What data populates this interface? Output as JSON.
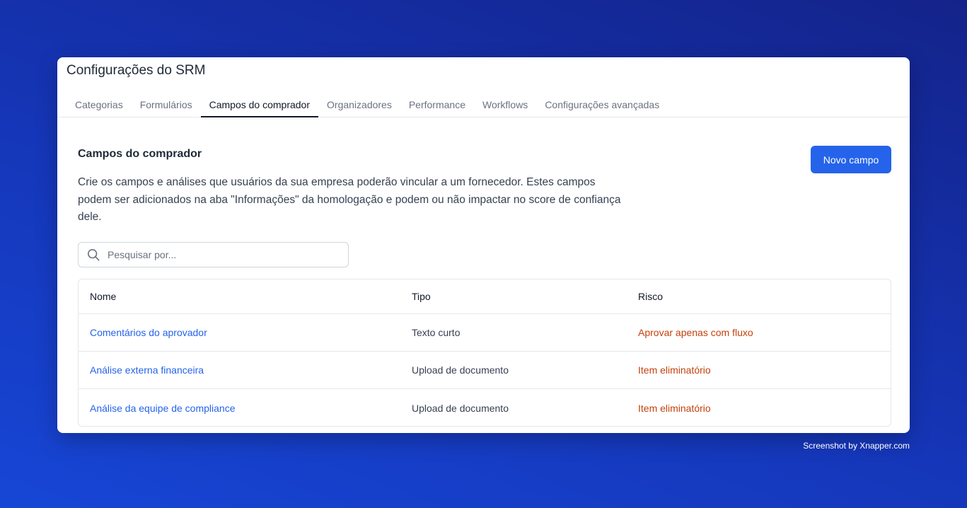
{
  "app": {
    "title": "Configurações do SRM"
  },
  "tabs": [
    {
      "label": "Categorias",
      "active": false
    },
    {
      "label": "Formulários",
      "active": false
    },
    {
      "label": "Campos do comprador",
      "active": true
    },
    {
      "label": "Organizadores",
      "active": false
    },
    {
      "label": "Performance",
      "active": false
    },
    {
      "label": "Workflows",
      "active": false
    },
    {
      "label": "Configurações avançadas",
      "active": false
    }
  ],
  "section": {
    "title": "Campos do comprador",
    "description": "Crie os campos e análises que usuários da sua empresa poderão vincular a um fornecedor. Estes campos podem ser adicionados na aba \"Informações\" da homologação e podem ou não impactar no score de confiança dele.",
    "new_button": "Novo campo"
  },
  "search": {
    "placeholder": "Pesquisar por...",
    "value": "",
    "icon": "search-icon"
  },
  "table": {
    "columns": [
      "Nome",
      "Tipo",
      "Risco"
    ],
    "rows": [
      {
        "name": "Comentários do aprovador",
        "type": "Texto curto",
        "risk": "Aprovar apenas com fluxo"
      },
      {
        "name": "Análise externa financeira",
        "type": "Upload de documento",
        "risk": "Item eliminatório"
      },
      {
        "name": "Análise da equipe de compliance",
        "type": "Upload de documento",
        "risk": "Item eliminatório"
      }
    ]
  },
  "colors": {
    "accent": "#2563eb",
    "risk": "#c2410c",
    "background_start": "#14238a",
    "background_end": "#1746d6"
  },
  "watermark": "Screenshot by Xnapper.com"
}
